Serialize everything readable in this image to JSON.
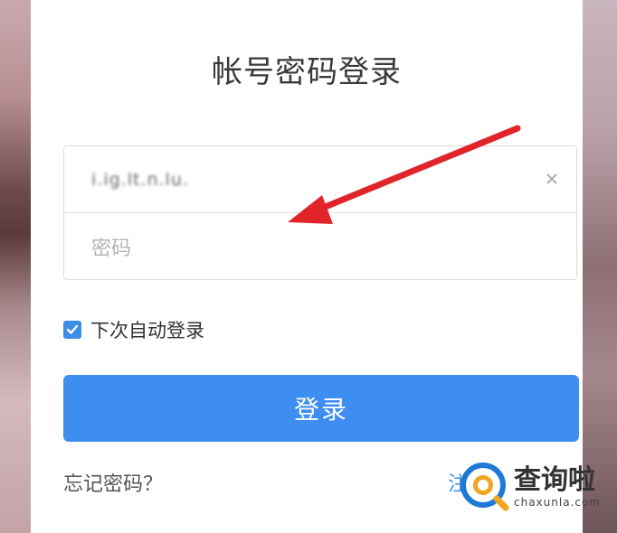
{
  "title": "帐号密码登录",
  "username": {
    "value": "i.ig.lt.n.lu.",
    "clear_icon": "close-icon"
  },
  "password": {
    "placeholder": "密码"
  },
  "remember": {
    "label": "下次自动登录",
    "checked": true
  },
  "login_button": {
    "label": "登录"
  },
  "forgot_link": "忘记密码？",
  "partial_link": "注",
  "watermark": {
    "name": "查询啦",
    "domain": "chaxunla.com"
  },
  "colors": {
    "accent": "#3d8ef0",
    "arrow": "#e0242a"
  }
}
